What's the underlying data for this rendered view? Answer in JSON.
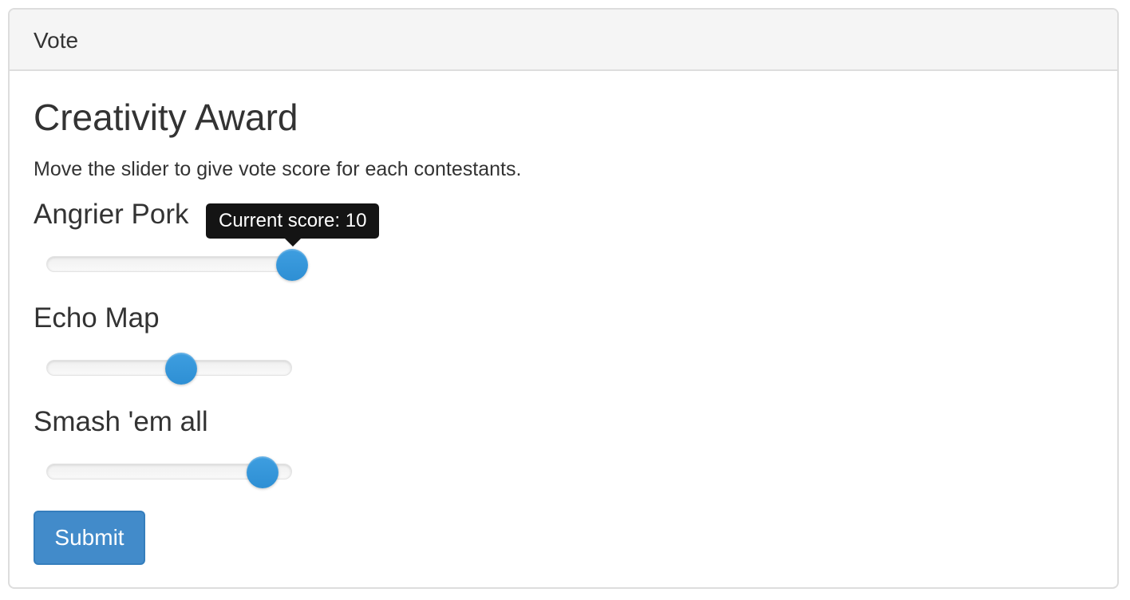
{
  "panel": {
    "heading": "Vote"
  },
  "award": {
    "title": "Creativity Award",
    "instructions": "Move the slider to give vote score for each contestants."
  },
  "contestants": [
    {
      "name": "Angrier Pork",
      "slider_fraction": 1.0
    },
    {
      "name": "Echo Map",
      "slider_fraction": 0.55
    },
    {
      "name": "Smash 'em all",
      "slider_fraction": 0.88
    }
  ],
  "tooltip": {
    "text": "Current score: 10"
  },
  "submit": {
    "label": "Submit"
  },
  "colors": {
    "accent": "#428bca",
    "handle": "#3498db",
    "tooltip_bg": "#141414"
  }
}
